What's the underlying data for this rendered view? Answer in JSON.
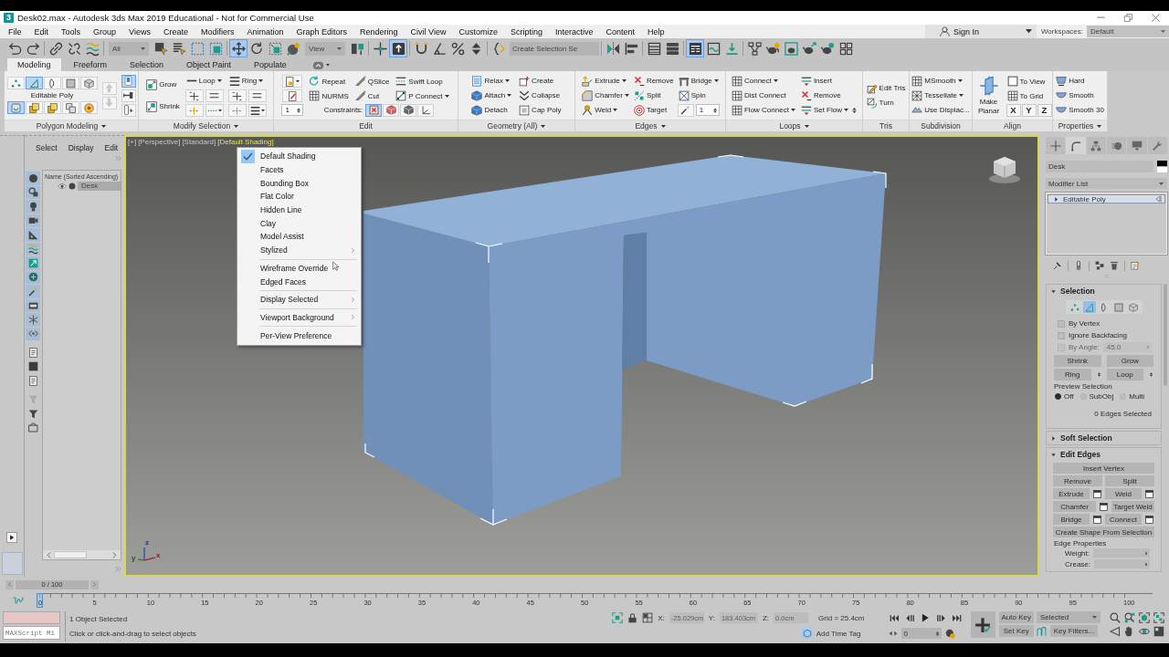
{
  "title_bar": {
    "logo": "3",
    "title": "Desk02.max - Autodesk 3ds Max 2019 Educational - Not for Commercial Use"
  },
  "menu_bar": {
    "items": [
      "File",
      "Edit",
      "Tools",
      "Group",
      "Views",
      "Create",
      "Modifiers",
      "Animation",
      "Graph Editors",
      "Rendering",
      "Civil View",
      "Customize",
      "Scripting",
      "Interactive",
      "Content",
      "Help"
    ],
    "sign_in": "Sign In",
    "workspaces_label": "Workspaces:",
    "workspace": "Default"
  },
  "main_toolbar": {
    "selection_filter": "All",
    "reference_coordinate": "View",
    "named_selection": {
      "placeholder": "Create Selection Se"
    },
    "tools": [
      {
        "selected": false
      },
      {
        "selected": false
      },
      {
        "selected": false
      },
      {
        "selected": false
      },
      {
        "selected": false
      },
      {
        "selected": false
      },
      {
        "selected": false
      },
      {
        "selected": false
      },
      {
        "selected": false
      },
      {
        "selected": true
      },
      {
        "selected": false
      },
      {
        "selected": false
      },
      {
        "selected": false
      },
      {
        "selected": false
      },
      {
        "selected": false
      },
      {
        "selected": true
      },
      {
        "selected": false
      },
      {
        "selected": false
      },
      {
        "selected": false
      },
      {
        "selected": false
      },
      {
        "selected": false
      },
      {
        "selected": false
      },
      {
        "selected": false
      },
      {
        "selected": false
      },
      {
        "selected": false
      },
      {
        "selected": true
      },
      {
        "selected": false
      },
      {
        "selected": false
      },
      {
        "selected": false
      },
      {
        "selected": false
      },
      {
        "selected": false
      },
      {
        "selected": false
      },
      {
        "selected": false
      },
      {
        "selected": false
      }
    ]
  },
  "ribbon": {
    "tabs": [
      {
        "label": "Modeling",
        "selected": true
      },
      {
        "label": "Freeform",
        "selected": false
      },
      {
        "label": "Selection",
        "selected": false
      },
      {
        "label": "Object Paint",
        "selected": false
      },
      {
        "label": "Populate",
        "selected": false
      }
    ],
    "panels": [
      {
        "kind": "polygon-modeling",
        "title": "Polygon Modeling",
        "dropdown": true,
        "label": "Editable Poly",
        "subobjects": [
          {
            "selected": false
          },
          {
            "selected": true
          },
          {
            "selected": false
          },
          {
            "selected": false
          },
          {
            "selected": false
          }
        ],
        "tools": [
          {
            "selected": true
          },
          {
            "selected": false
          },
          {
            "selected": false
          },
          {
            "selected": false
          },
          {
            "selected": false
          }
        ],
        "history": [
          {
            "disabled": true
          },
          {
            "disabled": true
          }
        ],
        "extras": [
          {
            "selected": true
          },
          {
            "selected": false
          },
          {
            "selected": false
          }
        ]
      },
      {
        "kind": "modify-selection",
        "title": "Modify Selection",
        "dropdown": true,
        "items": [
          {
            "kind": "button",
            "label": "Grow",
            "dropdown": false
          },
          {
            "kind": "button",
            "label": "Shrink",
            "dropdown": false
          },
          {
            "kind": "loop-group",
            "label": "Loop",
            "dropdown": true
          },
          {
            "kind": "loop-group",
            "label": "Ring",
            "dropdown": true
          }
        ]
      },
      {
        "kind": "edit",
        "title": "Edit",
        "dropdown": false,
        "items": [
          {
            "kind": "spinner-group",
            "value": "1"
          },
          {
            "kind": "button",
            "label": "Repeat",
            "dropdown": false
          },
          {
            "kind": "button",
            "label": "QSlice",
            "dropdown": false
          },
          {
            "kind": "button",
            "label": "Swift Loop",
            "dropdown": false
          },
          {
            "kind": "button",
            "label": "NURMS",
            "dropdown": false
          },
          {
            "kind": "button",
            "label": "Cut",
            "dropdown": false
          },
          {
            "kind": "button",
            "label": "P Connect",
            "dropdown": true
          },
          {
            "kind": "constraints",
            "label": "Constraints:",
            "buttons": [
              {
                "selected": true
              },
              {
                "selected": false
              },
              {
                "selected": false
              },
              {
                "selected": false
              }
            ]
          }
        ]
      },
      {
        "kind": "geometry",
        "title": "Geometry (All)",
        "dropdown": true,
        "items": [
          {
            "kind": "button",
            "label": "Relax",
            "dropdown": true
          },
          {
            "kind": "button",
            "label": "Create",
            "dropdown": false
          },
          {
            "kind": "button",
            "label": "Attach",
            "dropdown": true
          },
          {
            "kind": "button",
            "label": "Collapse",
            "dropdown": false
          },
          {
            "kind": "button",
            "label": "Detach",
            "dropdown": false
          },
          {
            "kind": "button",
            "label": "Cap Poly",
            "dropdown": false
          }
        ]
      },
      {
        "kind": "edges",
        "title": "Edges",
        "dropdown": true,
        "items": [
          {
            "kind": "button",
            "label": "Extrude",
            "dropdown": true
          },
          {
            "kind": "button",
            "label": "Remove",
            "dropdown": false
          },
          {
            "kind": "button",
            "label": "Bridge",
            "dropdown": true
          },
          {
            "kind": "button",
            "label": "Chamfer",
            "dropdown": true
          },
          {
            "kind": "button",
            "label": "Split",
            "dropdown": false
          },
          {
            "kind": "button",
            "label": "Spin",
            "dropdown": false
          },
          {
            "kind": "button",
            "label": "Weld",
            "dropdown": true
          },
          {
            "kind": "button",
            "label": "Target",
            "dropdown": false
          },
          {
            "kind": "spinner",
            "value": "1"
          }
        ]
      },
      {
        "kind": "loops",
        "title": "Loops",
        "dropdown": true,
        "items": [
          {
            "kind": "button",
            "label": "Connect",
            "dropdown": true
          },
          {
            "kind": "button",
            "label": "Insert",
            "dropdown": false
          },
          {
            "kind": "button",
            "label": "Dist Connect",
            "dropdown": false
          },
          {
            "kind": "button",
            "label": "Remove",
            "dropdown": false
          },
          {
            "kind": "button",
            "label": "Flow Connect",
            "dropdown": true
          },
          {
            "kind": "spin-button",
            "label": "Set Flow",
            "dropdown": true
          }
        ]
      },
      {
        "kind": "tris",
        "title": "Tris",
        "dropdown": false,
        "items": [
          {
            "kind": "button",
            "label": "Edit Tris",
            "dropdown": false
          },
          {
            "kind": "button",
            "label": "Turn",
            "dropdown": false
          }
        ]
      },
      {
        "kind": "subdivision",
        "title": "Subdivision",
        "dropdown": false,
        "items": [
          {
            "kind": "button",
            "label": "MSmooth",
            "dropdown": true
          },
          {
            "kind": "button",
            "label": "Tessellate",
            "dropdown": true
          },
          {
            "kind": "button",
            "label": "Use Displac...",
            "dropdown": false
          }
        ]
      },
      {
        "kind": "align",
        "title": "Align",
        "dropdown": false,
        "items": [
          {
            "kind": "large-button",
            "label": "Make Planar"
          },
          {
            "kind": "button",
            "label": "To View",
            "dropdown": false
          },
          {
            "kind": "button",
            "label": "To Grid",
            "dropdown": false
          },
          {
            "kind": "axes",
            "labels": [
              "X",
              "Y",
              "Z"
            ]
          }
        ]
      },
      {
        "kind": "properties",
        "title": "Properties",
        "dropdown": true,
        "items": [
          {
            "kind": "button",
            "label": "Hard",
            "dropdown": false
          },
          {
            "kind": "button",
            "label": "Smooth",
            "dropdown": false
          },
          {
            "kind": "button",
            "label": "Smooth 30",
            "dropdown": false
          }
        ]
      }
    ]
  },
  "scene_explorer": {
    "menus": [
      "Select",
      "Display",
      "Edit"
    ],
    "filters": [
      {
        "on": true
      },
      {
        "on": true
      },
      {
        "on": true
      },
      {
        "on": true
      },
      {
        "on": true
      },
      {
        "on": true
      },
      {
        "on": true
      },
      {
        "on": true
      },
      {
        "on": true
      },
      {
        "on": true
      },
      {
        "on": true
      },
      {
        "on": true
      },
      {
        "on": false
      },
      {
        "on": false
      },
      {
        "on": false
      },
      {
        "on": false
      },
      {
        "on": false
      },
      {
        "on": false
      }
    ],
    "column": "Name (Sorted Ascending)",
    "rows": [
      {
        "name": "Desk",
        "selected": true
      }
    ]
  },
  "viewport": {
    "labels": [
      {
        "text": "[+]",
        "selected": false
      },
      {
        "text": "[Perspective]",
        "selected": false
      },
      {
        "text": "[Standard]",
        "selected": false
      },
      {
        "text": "[Default Shading]",
        "selected": true
      }
    ],
    "menu": {
      "groups": [
        [
          {
            "label": "Default Shading",
            "checked": true,
            "submenu": false
          },
          {
            "label": "Facets",
            "checked": false,
            "submenu": false
          },
          {
            "label": "Bounding Box",
            "checked": false,
            "submenu": false
          },
          {
            "label": "Flat Color",
            "checked": false,
            "submenu": false
          },
          {
            "label": "Hidden Line",
            "checked": false,
            "submenu": false
          },
          {
            "label": "Clay",
            "checked": false,
            "submenu": false
          },
          {
            "label": "Model Assist",
            "checked": false,
            "submenu": false
          },
          {
            "label": "Stylized",
            "checked": false,
            "submenu": true
          }
        ],
        [
          {
            "label": "Wireframe Override",
            "checked": false,
            "submenu": false
          },
          {
            "label": "Edged Faces",
            "checked": false,
            "submenu": false
          }
        ],
        [
          {
            "label": "Display Selected",
            "checked": false,
            "submenu": true
          }
        ],
        [
          {
            "label": "Viewport Background",
            "checked": false,
            "submenu": true
          }
        ],
        [
          {
            "label": "Per-View Preference",
            "checked": false,
            "submenu": false
          }
        ]
      ]
    },
    "axis_labels": [
      "z",
      "y",
      "x"
    ]
  },
  "command_panel": {
    "tabs": [
      {
        "selected": false
      },
      {
        "selected": true
      },
      {
        "selected": false
      },
      {
        "selected": false
      },
      {
        "selected": false
      },
      {
        "selected": false
      }
    ],
    "object_name": "Desk",
    "modifier_list": "Modifier List",
    "stack": [
      {
        "label": "Editable Poly",
        "selected": true
      }
    ],
    "rollouts": [
      {
        "kind": "selection",
        "title": "Selection",
        "expanded": true,
        "subobjects": [
          {
            "selected": false
          },
          {
            "selected": true
          },
          {
            "selected": false
          },
          {
            "selected": false
          },
          {
            "selected": false
          }
        ],
        "checkboxes": [
          {
            "label": "By Vertex",
            "checked": false
          },
          {
            "label": "Ignore Backfacing",
            "checked": false
          }
        ],
        "angle": {
          "label": "By Angle:",
          "value": "45.0",
          "disabled": true
        },
        "buttons": [
          "Shrink",
          "Grow"
        ],
        "spin_buttons": [
          "Ring",
          "Loop"
        ],
        "preview": {
          "label": "Preview Selection",
          "options": [
            {
              "label": "Off",
              "selected": true
            },
            {
              "label": "SubObj",
              "selected": false
            },
            {
              "label": "Multi",
              "selected": false
            }
          ]
        },
        "status": "0 Edges Selected"
      },
      {
        "kind": "soft-selection",
        "title": "Soft Selection",
        "expanded": false
      },
      {
        "kind": "edit-edges",
        "title": "Edit Edges",
        "expanded": true,
        "rows": [
          [
            {
              "label": "Insert Vertex",
              "settings": false
            }
          ],
          [
            {
              "label": "Remove",
              "settings": false
            },
            {
              "label": "Split",
              "settings": false
            }
          ],
          [
            {
              "label": "Extrude",
              "settings": true
            },
            {
              "label": "Weld",
              "settings": true
            }
          ],
          [
            {
              "label": "Chamfer",
              "settings": true
            },
            {
              "label": "Target Weld",
              "settings": false
            }
          ],
          [
            {
              "label": "Bridge",
              "settings": true
            },
            {
              "label": "Connect",
              "settings": true
            }
          ],
          [
            {
              "label": "Create Shape From Selection",
              "settings": false
            }
          ]
        ],
        "group": {
          "title": "Edge Properties",
          "fields": [
            {
              "label": "Weight:"
            },
            {
              "label": "Crease:"
            }
          ]
        }
      }
    ]
  },
  "time_slider": {
    "label": "0 / 100"
  },
  "track_bar": {
    "ticks": [
      "0",
      "5",
      "10",
      "15",
      "20",
      "25",
      "30",
      "35",
      "40",
      "45",
      "50",
      "55",
      "60",
      "65",
      "70",
      "75",
      "80",
      "85",
      "90",
      "95",
      "100"
    ]
  },
  "status_bar": {
    "listener": {
      "placeholder": "MAXScript Mi"
    },
    "prompt": "1 Object Selected",
    "hint": "Click or click-and-drag to select objects",
    "coords": [
      {
        "label": "X:",
        "value": "-25.029cm",
        "disabled": true
      },
      {
        "label": "Y:",
        "value": "183.403cm",
        "disabled": true
      },
      {
        "label": "Z:",
        "value": "0.0cm",
        "disabled": true
      }
    ],
    "grid": "Grid = 25.4cm",
    "time_tag": "Add Time Tag",
    "frame": "0",
    "auto_key": "Auto Key",
    "set_key": "Set Key",
    "key_set": "Selected",
    "key_filters": "Key Filters..."
  }
}
